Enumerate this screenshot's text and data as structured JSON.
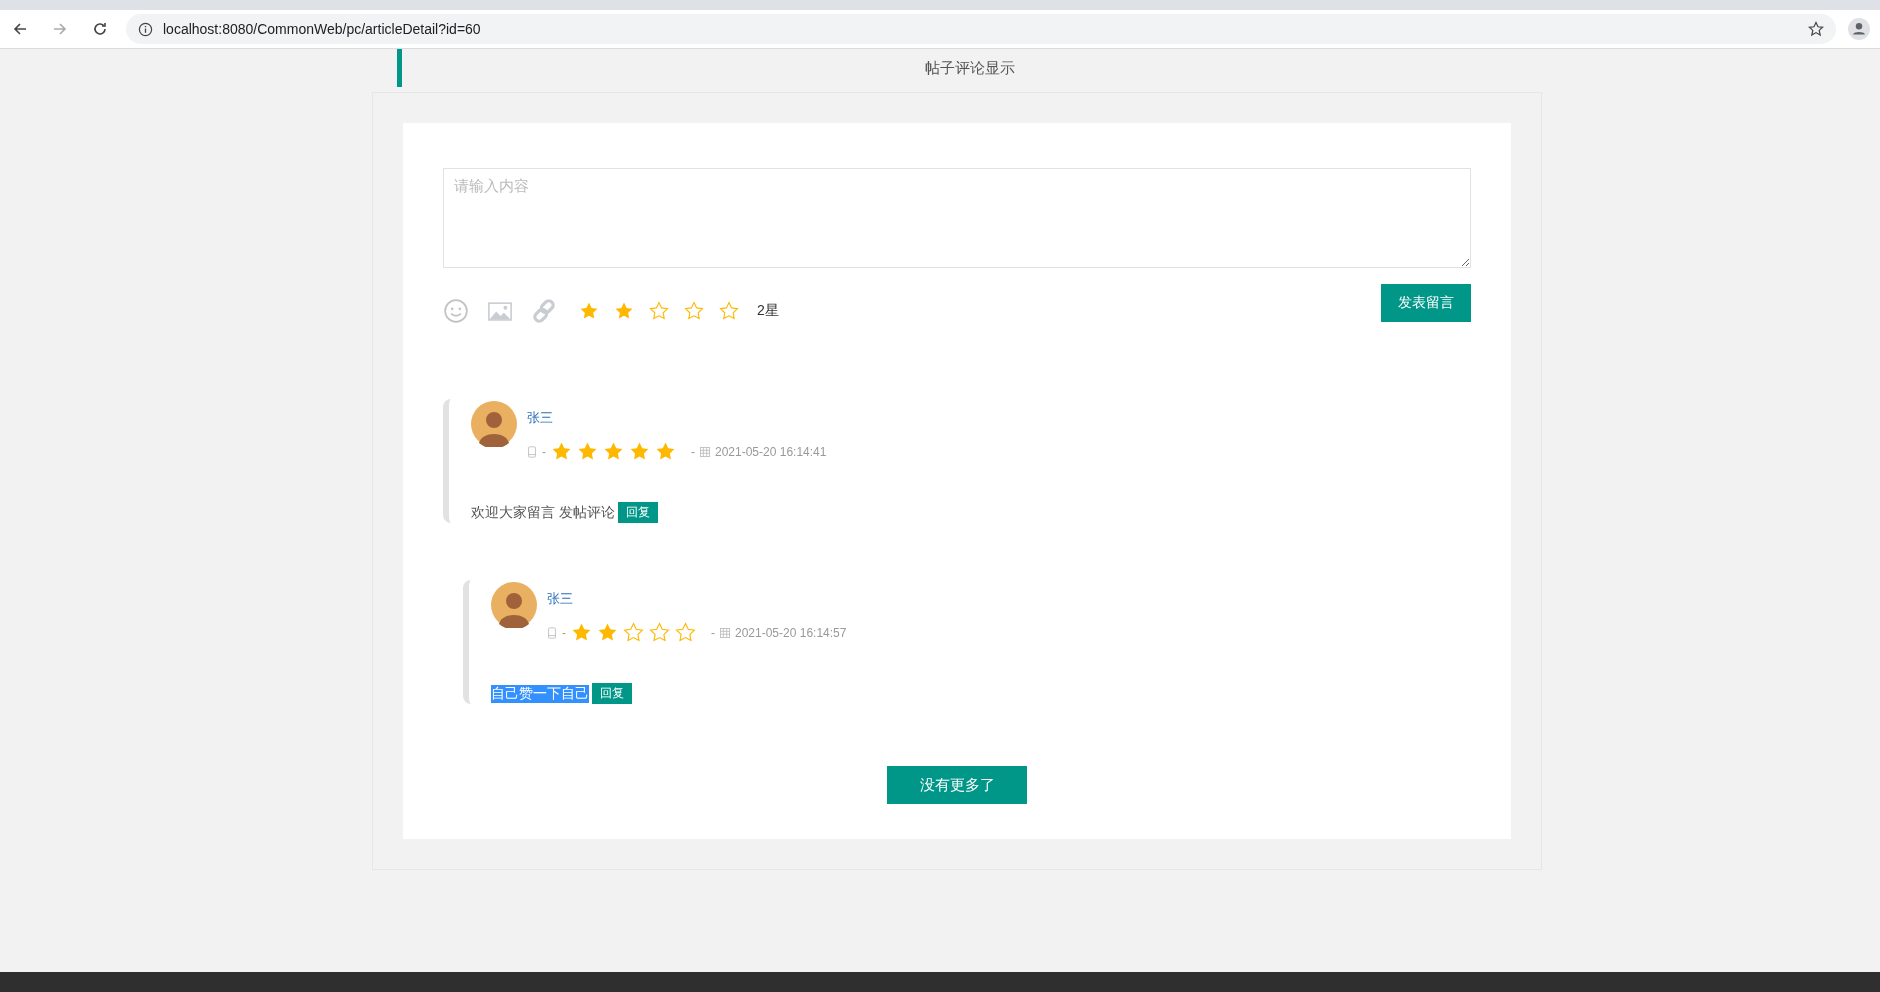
{
  "browser": {
    "url": "localhost:8080/CommonWeb/pc/articleDetail?id=60"
  },
  "section_title": "帖子评论显示",
  "editor": {
    "placeholder": "请输入内容",
    "stars": 2,
    "rating_label": "2星",
    "submit": "发表留言"
  },
  "comments": [
    {
      "author": "张三",
      "separator_1": "-",
      "stars": 5,
      "separator_2": "-",
      "time": "2021-05-20 16:14:41",
      "text": "欢迎大家留言 发帖评论",
      "text_highlighted": false,
      "reply": "回复",
      "nested": false
    },
    {
      "author": "张三",
      "separator_1": "-",
      "stars": 2,
      "separator_2": "-",
      "time": "2021-05-20 16:14:57",
      "text": "自己赞一下自己",
      "text_highlighted": true,
      "reply": "回复",
      "nested": true
    }
  ],
  "more_button": "没有更多了"
}
